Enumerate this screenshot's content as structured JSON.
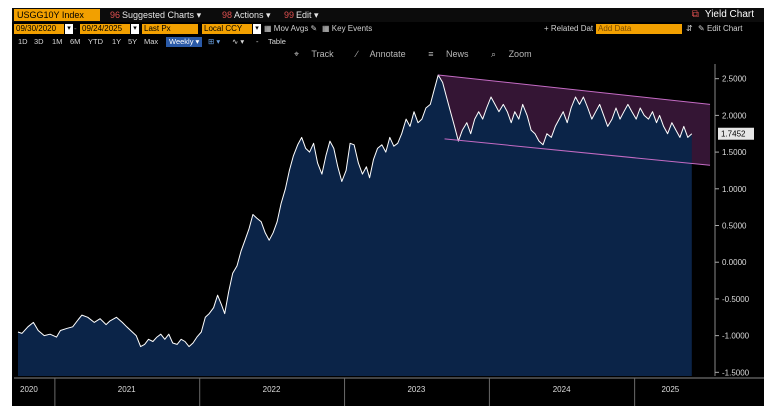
{
  "toolbar": {
    "ticker": "USGG10Y Index",
    "menu": [
      "Suggested Charts",
      "Actions",
      "Edit"
    ],
    "yield_chart": "Yield Chart",
    "start_date": "09/30/2020",
    "end_date": "09/24/2025",
    "price_field": "Last Px",
    "currency": "Local CCY",
    "mov_avgs": "Mov Avgs",
    "key_events": "Key Events",
    "related_dat": "+ Related Dat",
    "add_data": "Add Data",
    "edit_chart": "Edit Chart",
    "ranges": [
      "1D",
      "3D",
      "1M",
      "6M",
      "YTD",
      "1Y",
      "5Y",
      "Max"
    ],
    "frequency": "Weekly",
    "table": "Table",
    "tools": [
      "Track",
      "Annotate",
      "News",
      "Zoom"
    ]
  },
  "colors": {
    "background": "#000000",
    "area_fill": "#0b2448",
    "line": "#ffffff",
    "channel": "#c46bc4",
    "channel_fill": "rgba(150,60,150,0.35)",
    "accent_orange": "#f2a000"
  },
  "chart_data": {
    "type": "area",
    "title": "USGG10Y Index",
    "x_tick_labels": [
      "2020",
      "2021",
      "2022",
      "2023",
      "2024",
      "2025"
    ],
    "y_ticks": [
      2.5,
      2.0,
      1.5,
      1.0,
      0.5,
      0.0,
      -0.5,
      -1.0,
      -1.5
    ],
    "y_tick_labels": [
      "2.5000",
      "2.0000",
      "1.5000",
      "1.0000",
      "0.5000",
      "0.0000",
      "-0.5000",
      "-1.0000",
      "-1.5000"
    ],
    "ylim": [
      -1.55,
      2.7
    ],
    "last_value": "1.7452",
    "grid": false,
    "series": [
      {
        "name": "USGG10Y Index",
        "points": [
          [
            "2020-09-30",
            -0.95
          ],
          [
            "2020-10-10",
            -0.97
          ],
          [
            "2020-10-25",
            -0.88
          ],
          [
            "2020-11-08",
            -0.82
          ],
          [
            "2020-11-20",
            -0.93
          ],
          [
            "2020-12-05",
            -1.0
          ],
          [
            "2020-12-20",
            -0.98
          ],
          [
            "2021-01-05",
            -1.02
          ],
          [
            "2021-01-15",
            -0.93
          ],
          [
            "2021-02-01",
            -0.9
          ],
          [
            "2021-02-15",
            -0.88
          ],
          [
            "2021-03-01",
            -0.78
          ],
          [
            "2021-03-10",
            -0.72
          ],
          [
            "2021-03-25",
            -0.75
          ],
          [
            "2021-04-10",
            -0.82
          ],
          [
            "2021-04-25",
            -0.77
          ],
          [
            "2021-05-10",
            -0.85
          ],
          [
            "2021-05-20",
            -0.8
          ],
          [
            "2021-06-05",
            -0.75
          ],
          [
            "2021-06-20",
            -0.82
          ],
          [
            "2021-07-01",
            -0.88
          ],
          [
            "2021-07-15",
            -0.95
          ],
          [
            "2021-07-25",
            -1.0
          ],
          [
            "2021-08-05",
            -1.15
          ],
          [
            "2021-08-15",
            -1.12
          ],
          [
            "2021-08-25",
            -1.05
          ],
          [
            "2021-09-05",
            -1.08
          ],
          [
            "2021-09-15",
            -1.02
          ],
          [
            "2021-09-25",
            -0.98
          ],
          [
            "2021-10-05",
            -1.05
          ],
          [
            "2021-10-15",
            -0.98
          ],
          [
            "2021-10-25",
            -1.1
          ],
          [
            "2021-11-05",
            -1.12
          ],
          [
            "2021-11-15",
            -1.05
          ],
          [
            "2021-11-25",
            -1.08
          ],
          [
            "2021-12-05",
            -1.15
          ],
          [
            "2021-12-15",
            -1.1
          ],
          [
            "2021-12-25",
            -1.02
          ],
          [
            "2022-01-05",
            -0.95
          ],
          [
            "2022-01-15",
            -0.75
          ],
          [
            "2022-01-25",
            -0.7
          ],
          [
            "2022-02-05",
            -0.62
          ],
          [
            "2022-02-15",
            -0.45
          ],
          [
            "2022-02-25",
            -0.58
          ],
          [
            "2022-03-05",
            -0.7
          ],
          [
            "2022-03-15",
            -0.4
          ],
          [
            "2022-03-25",
            -0.15
          ],
          [
            "2022-04-05",
            -0.05
          ],
          [
            "2022-04-15",
            0.15
          ],
          [
            "2022-04-25",
            0.3
          ],
          [
            "2022-05-05",
            0.45
          ],
          [
            "2022-05-15",
            0.65
          ],
          [
            "2022-05-25",
            0.6
          ],
          [
            "2022-06-05",
            0.55
          ],
          [
            "2022-06-15",
            0.4
          ],
          [
            "2022-06-25",
            0.3
          ],
          [
            "2022-07-05",
            0.4
          ],
          [
            "2022-07-15",
            0.55
          ],
          [
            "2022-07-25",
            0.8
          ],
          [
            "2022-08-05",
            1.0
          ],
          [
            "2022-08-15",
            1.25
          ],
          [
            "2022-08-25",
            1.45
          ],
          [
            "2022-09-05",
            1.6
          ],
          [
            "2022-09-15",
            1.7
          ],
          [
            "2022-09-25",
            1.55
          ],
          [
            "2022-10-05",
            1.5
          ],
          [
            "2022-10-15",
            1.62
          ],
          [
            "2022-10-25",
            1.35
          ],
          [
            "2022-11-05",
            1.2
          ],
          [
            "2022-11-15",
            1.45
          ],
          [
            "2022-11-25",
            1.65
          ],
          [
            "2022-12-05",
            1.55
          ],
          [
            "2022-12-15",
            1.3
          ],
          [
            "2022-12-25",
            1.1
          ],
          [
            "2023-01-05",
            1.25
          ],
          [
            "2023-01-15",
            1.62
          ],
          [
            "2023-01-25",
            1.6
          ],
          [
            "2023-02-05",
            1.35
          ],
          [
            "2023-02-15",
            1.2
          ],
          [
            "2023-02-25",
            1.3
          ],
          [
            "2023-03-05",
            1.15
          ],
          [
            "2023-03-15",
            1.4
          ],
          [
            "2023-03-25",
            1.55
          ],
          [
            "2023-04-05",
            1.6
          ],
          [
            "2023-04-15",
            1.5
          ],
          [
            "2023-04-25",
            1.7
          ],
          [
            "2023-05-05",
            1.58
          ],
          [
            "2023-05-15",
            1.62
          ],
          [
            "2023-05-25",
            1.75
          ],
          [
            "2023-06-05",
            1.95
          ],
          [
            "2023-06-15",
            1.85
          ],
          [
            "2023-06-25",
            2.05
          ],
          [
            "2023-07-05",
            1.9
          ],
          [
            "2023-07-15",
            1.95
          ],
          [
            "2023-07-25",
            2.1
          ],
          [
            "2023-08-05",
            2.15
          ],
          [
            "2023-08-15",
            2.35
          ],
          [
            "2023-08-25",
            2.55
          ],
          [
            "2023-09-05",
            2.45
          ],
          [
            "2023-09-15",
            2.25
          ],
          [
            "2023-09-25",
            2.05
          ],
          [
            "2023-10-05",
            1.85
          ],
          [
            "2023-10-15",
            1.65
          ],
          [
            "2023-10-25",
            1.8
          ],
          [
            "2023-11-05",
            1.9
          ],
          [
            "2023-11-15",
            1.75
          ],
          [
            "2023-11-25",
            1.95
          ],
          [
            "2023-12-05",
            2.05
          ],
          [
            "2023-12-15",
            1.95
          ],
          [
            "2023-12-25",
            2.1
          ],
          [
            "2024-01-05",
            2.25
          ],
          [
            "2024-01-15",
            2.15
          ],
          [
            "2024-01-25",
            2.05
          ],
          [
            "2024-02-05",
            2.15
          ],
          [
            "2024-02-15",
            2.05
          ],
          [
            "2024-02-25",
            1.9
          ],
          [
            "2024-03-05",
            2.05
          ],
          [
            "2024-03-15",
            1.95
          ],
          [
            "2024-03-25",
            2.15
          ],
          [
            "2024-04-05",
            2.0
          ],
          [
            "2024-04-15",
            1.8
          ],
          [
            "2024-04-25",
            1.75
          ],
          [
            "2024-05-05",
            1.65
          ],
          [
            "2024-05-15",
            1.6
          ],
          [
            "2024-05-25",
            1.75
          ],
          [
            "2024-06-05",
            1.7
          ],
          [
            "2024-06-15",
            1.85
          ],
          [
            "2024-06-25",
            1.95
          ],
          [
            "2024-07-05",
            2.05
          ],
          [
            "2024-07-15",
            1.9
          ],
          [
            "2024-07-25",
            2.1
          ],
          [
            "2024-08-05",
            2.25
          ],
          [
            "2024-08-15",
            2.15
          ],
          [
            "2024-08-25",
            2.25
          ],
          [
            "2024-09-05",
            2.1
          ],
          [
            "2024-09-15",
            1.95
          ],
          [
            "2024-09-25",
            2.05
          ],
          [
            "2024-10-05",
            2.15
          ],
          [
            "2024-10-15",
            2.0
          ],
          [
            "2024-10-25",
            1.85
          ],
          [
            "2024-11-05",
            1.95
          ],
          [
            "2024-11-15",
            2.1
          ],
          [
            "2024-11-25",
            1.95
          ],
          [
            "2024-12-05",
            2.05
          ],
          [
            "2024-12-15",
            2.15
          ],
          [
            "2024-12-25",
            2.05
          ],
          [
            "2025-01-05",
            1.95
          ],
          [
            "2025-01-15",
            2.1
          ],
          [
            "2025-01-25",
            2.0
          ],
          [
            "2025-02-05",
            1.95
          ],
          [
            "2025-02-15",
            2.05
          ],
          [
            "2025-02-25",
            1.9
          ],
          [
            "2025-03-05",
            2.0
          ],
          [
            "2025-03-15",
            1.85
          ],
          [
            "2025-03-25",
            1.75
          ],
          [
            "2025-04-05",
            1.9
          ],
          [
            "2025-04-15",
            1.8
          ],
          [
            "2025-04-25",
            1.7
          ],
          [
            "2025-05-05",
            1.85
          ],
          [
            "2025-05-15",
            1.7
          ],
          [
            "2025-05-25",
            1.75
          ]
        ]
      }
    ],
    "channel": {
      "upper": [
        [
          "2023-08-25",
          2.55
        ],
        [
          "2025-07-10",
          2.15
        ]
      ],
      "lower": [
        [
          "2023-09-10",
          1.68
        ],
        [
          "2025-07-10",
          1.32
        ]
      ]
    }
  }
}
